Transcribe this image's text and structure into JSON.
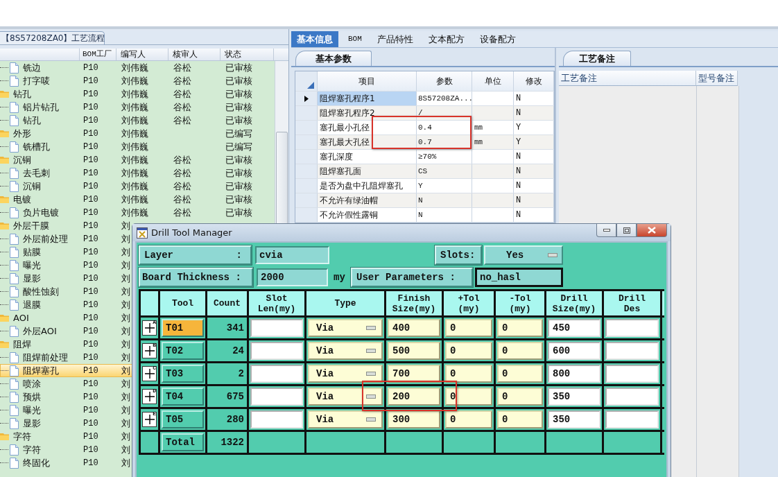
{
  "left_panel": {
    "tab": "【8S57208ZA0】工艺流程",
    "columns": [
      "BOM工厂",
      "编写人",
      "核审人",
      "状态"
    ],
    "tree": [
      {
        "children": [
          {
            "kind": "step",
            "label": "铣边",
            "bom": "P10",
            "editor": "刘伟巍",
            "reviewer": "谷松",
            "status": "已审核",
            "selected": false
          },
          {
            "kind": "step",
            "label": "打字唛",
            "bom": "P10",
            "editor": "刘伟巍",
            "reviewer": "谷松",
            "status": "已审核",
            "selected": false
          }
        ]
      },
      {
        "kind": "folder",
        "label": "钻孔",
        "bom": "P10",
        "editor": "刘伟巍",
        "reviewer": "谷松",
        "status": "已审核",
        "selected": false,
        "children": [
          {
            "kind": "step",
            "label": "铝片钻孔",
            "bom": "P10",
            "editor": "刘伟巍",
            "reviewer": "谷松",
            "status": "已审核",
            "selected": false
          },
          {
            "kind": "step",
            "label": "钻孔",
            "bom": "P10",
            "editor": "刘伟巍",
            "reviewer": "谷松",
            "status": "已审核",
            "selected": false
          }
        ]
      },
      {
        "kind": "folder",
        "label": "外形",
        "bom": "P10",
        "editor": "刘伟巍",
        "status": "已编写",
        "selected": false,
        "children": [
          {
            "kind": "step",
            "label": "铣槽孔",
            "bom": "P10",
            "editor": "刘伟巍",
            "status": "已编写",
            "selected": false
          }
        ]
      },
      {
        "kind": "folder",
        "label": "沉铜",
        "bom": "P10",
        "editor": "刘伟巍",
        "reviewer": "谷松",
        "status": "已审核",
        "selected": false,
        "children": [
          {
            "kind": "step",
            "label": "去毛刺",
            "bom": "P10",
            "editor": "刘伟巍",
            "reviewer": "谷松",
            "status": "已审核",
            "selected": false
          },
          {
            "kind": "step",
            "label": "沉铜",
            "bom": "P10",
            "editor": "刘伟巍",
            "reviewer": "谷松",
            "status": "已审核",
            "selected": false
          }
        ]
      },
      {
        "kind": "folder",
        "label": "电镀",
        "bom": "P10",
        "editor": "刘伟巍",
        "reviewer": "谷松",
        "status": "已审核",
        "selected": false,
        "children": [
          {
            "kind": "step",
            "label": "负片电镀",
            "bom": "P10",
            "editor": "刘伟巍",
            "reviewer": "谷松",
            "status": "已审核",
            "selected": false
          }
        ]
      },
      {
        "kind": "folder",
        "label": "外层干膜",
        "bom": "P10",
        "editor": "刘",
        "selected": false,
        "children": [
          {
            "kind": "step",
            "label": "外层前处理",
            "bom": "P10",
            "editor": "刘",
            "selected": false
          },
          {
            "kind": "step",
            "label": "贴膜",
            "bom": "P10",
            "editor": "刘",
            "selected": false
          },
          {
            "kind": "step",
            "label": "曝光",
            "bom": "P10",
            "editor": "刘",
            "selected": false
          },
          {
            "kind": "step",
            "label": "显影",
            "bom": "P10",
            "editor": "刘",
            "selected": false
          },
          {
            "kind": "step",
            "label": "酸性蚀刻",
            "bom": "P10",
            "editor": "刘",
            "selected": false
          },
          {
            "kind": "step",
            "label": "退膜",
            "bom": "P10",
            "editor": "刘",
            "selected": false
          }
        ]
      },
      {
        "kind": "folder",
        "label": "AOI",
        "bom": "P10",
        "editor": "刘",
        "selected": false,
        "children": [
          {
            "kind": "step",
            "label": "外层AOI",
            "bom": "P10",
            "editor": "刘",
            "selected": false
          }
        ]
      },
      {
        "kind": "folder",
        "label": "阻焊",
        "bom": "P10",
        "editor": "刘",
        "selected": false,
        "children": [
          {
            "kind": "step",
            "label": "阻焊前处理",
            "bom": "P10",
            "editor": "刘",
            "selected": false
          },
          {
            "kind": "step",
            "label": "阻焊塞孔",
            "bom": "P10",
            "editor": "刘",
            "selected": true
          },
          {
            "kind": "step",
            "label": "喷涂",
            "bom": "P10",
            "editor": "刘",
            "selected": false
          },
          {
            "kind": "step",
            "label": "预烘",
            "bom": "P10",
            "editor": "刘",
            "selected": false
          },
          {
            "kind": "step",
            "label": "曝光",
            "bom": "P10",
            "editor": "刘",
            "selected": false
          },
          {
            "kind": "step",
            "label": "显影",
            "bom": "P10",
            "editor": "刘",
            "selected": false
          }
        ]
      },
      {
        "kind": "folder",
        "label": "字符",
        "bom": "P10",
        "editor": "刘",
        "selected": false,
        "children": [
          {
            "kind": "step",
            "label": "字符",
            "bom": "P10",
            "editor": "刘",
            "selected": false
          },
          {
            "kind": "step",
            "label": "终固化",
            "bom": "P10",
            "editor": "刘",
            "selected": false
          }
        ]
      }
    ]
  },
  "tabs": [
    {
      "label": "基本信息",
      "selected": true
    },
    {
      "label": "BOM",
      "selected": false
    },
    {
      "label": "产品特性",
      "selected": false
    },
    {
      "label": "文本配方",
      "selected": false
    },
    {
      "label": "设备配方",
      "selected": false
    }
  ],
  "params_panel": {
    "tab": "基本参数",
    "columns": [
      "项目",
      "参数",
      "单位",
      "修改"
    ],
    "rows": [
      {
        "item": "阻焊塞孔程序1",
        "value": "8S57208ZA...",
        "modified": "N",
        "selected": true
      },
      {
        "item": "阻焊塞孔程序2",
        "value": "/",
        "modified": "N",
        "selected": false
      },
      {
        "item": "塞孔最小孔径",
        "value": "0.4",
        "unit": "mm",
        "modified": "Y",
        "selected": false
      },
      {
        "item": "塞孔最大孔径",
        "value": "0.7",
        "unit": "mm",
        "modified": "Y",
        "selected": false
      },
      {
        "item": "塞孔深度",
        "value": "≥70%",
        "modified": "N",
        "selected": false
      },
      {
        "item": "阻焊塞孔面",
        "value": "CS",
        "modified": "N",
        "selected": false
      },
      {
        "item": "是否为盘中孔阻焊塞孔",
        "value": "Y",
        "modified": "N",
        "selected": false
      },
      {
        "item": "不允许有绿油帽",
        "value": "N",
        "modified": "N",
        "selected": false
      },
      {
        "item": "不允许假性露铜",
        "value": "N",
        "modified": "N",
        "selected": false
      }
    ]
  },
  "notes_panel": {
    "tab": "工艺备注",
    "columns": [
      "工艺备注",
      "型号备注"
    ]
  },
  "dialog": {
    "title": "Drill Tool Manager",
    "layer": {
      "label": "Layer",
      "colon": ":",
      "value": "cvia"
    },
    "slots": {
      "label": "Slots:",
      "value": "Yes"
    },
    "thickness": {
      "label": "Board Thickness :",
      "value": "2000",
      "unit": "my"
    },
    "user_params": {
      "label": "User Parameters :",
      "value": "no_hasl"
    },
    "columns": [
      "Tool",
      "Count",
      "Slot\nLen(my)",
      "Type",
      "Finish\nSize(my)",
      "+Tol\n(my)",
      "-Tol\n(my)",
      "Drill\nSize(my)",
      "Drill\nDes"
    ],
    "rows": [
      {
        "letter": "A",
        "tool": "T01",
        "selected": true,
        "count": "341",
        "type": "Via",
        "finish": "400",
        "plus_tol": "0",
        "minus_tol": "0",
        "drill": "450"
      },
      {
        "letter": "B",
        "tool": "T02",
        "selected": false,
        "count": "24",
        "type": "Via",
        "finish": "500",
        "plus_tol": "0",
        "minus_tol": "0",
        "drill": "600"
      },
      {
        "letter": "C",
        "tool": "T03",
        "selected": false,
        "count": "2",
        "type": "Via",
        "finish": "700",
        "plus_tol": "0",
        "minus_tol": "0",
        "drill": "800"
      },
      {
        "letter": "D",
        "tool": "T04",
        "selected": false,
        "count": "675",
        "type": "Via",
        "finish": "200",
        "plus_tol": "0",
        "minus_tol": "0",
        "drill": "350"
      },
      {
        "letter": "E",
        "tool": "T05",
        "selected": false,
        "count": "280",
        "type": "Via",
        "finish": "300",
        "plus_tol": "0",
        "minus_tol": "0",
        "drill": "350"
      }
    ],
    "total": {
      "label": "Total",
      "count": "1322"
    }
  }
}
